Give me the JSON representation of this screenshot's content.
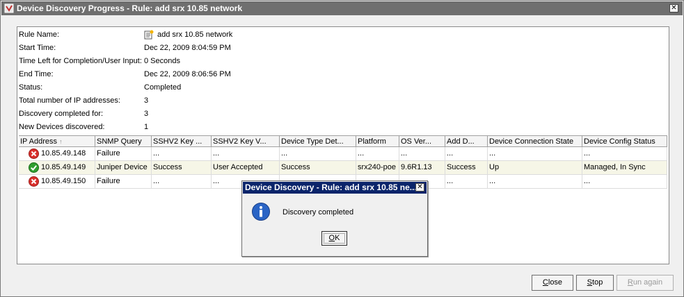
{
  "window": {
    "title": "Device Discovery Progress - Rule: add srx 10.85 network"
  },
  "info": [
    {
      "label": "Rule Name:",
      "value": "add srx 10.85 network",
      "icon": "rule-icon"
    },
    {
      "label": "Start Time:",
      "value": "Dec 22, 2009 8:04:59 PM"
    },
    {
      "label": "Time Left for Completion/User Input:",
      "value": "0 Seconds"
    },
    {
      "label": "End Time:",
      "value": "Dec 22, 2009 8:06:56 PM"
    },
    {
      "label": "Status:",
      "value": "Completed"
    },
    {
      "label": "Total number of IP addresses:",
      "value": "3"
    },
    {
      "label": "Discovery completed for:",
      "value": "3"
    },
    {
      "label": "New Devices discovered:",
      "value": "1"
    }
  ],
  "table": {
    "sort_indicator": "↑",
    "columns": [
      "IP Address",
      "SNMP Query",
      "SSHV2 Key ...",
      "SSHV2 Key V...",
      "Device Type Det...",
      "Platform",
      "OS Ver...",
      "Add D...",
      "Device Connection State",
      "Device Config Status"
    ],
    "rows": [
      {
        "status": "failure-icon",
        "cells": [
          "10.85.49.148",
          "Failure",
          "...",
          "...",
          "...",
          "...",
          "...",
          "...",
          "...",
          "..."
        ]
      },
      {
        "status": "success-icon",
        "cells": [
          "10.85.49.149",
          "Juniper Device",
          "Success",
          "User Accepted",
          "Success",
          "srx240-poe",
          "9.6R1.13",
          "Success",
          "Up",
          "Managed, In Sync"
        ]
      },
      {
        "status": "failure-icon",
        "cells": [
          "10.85.49.150",
          "Failure",
          "...",
          "...",
          "",
          "",
          "",
          "...",
          "...",
          "..."
        ]
      }
    ]
  },
  "buttons": {
    "close": {
      "mnemonic": "C",
      "rest": "lose"
    },
    "stop": {
      "mnemonic": "S",
      "rest": "top"
    },
    "run_again": {
      "mnemonic": "R",
      "rest": "un again"
    }
  },
  "dialog": {
    "title": "Device Discovery - Rule: add srx 10.85 ne...",
    "message": "Discovery completed",
    "ok": {
      "mnemonic": "O",
      "rest": "K"
    }
  },
  "colors": {
    "titlebar": "#6f6f6f",
    "dialog_titlebar": "#0a246a",
    "failure": "#d9302c",
    "success": "#2f9e2f",
    "info": "#2a64c5"
  }
}
